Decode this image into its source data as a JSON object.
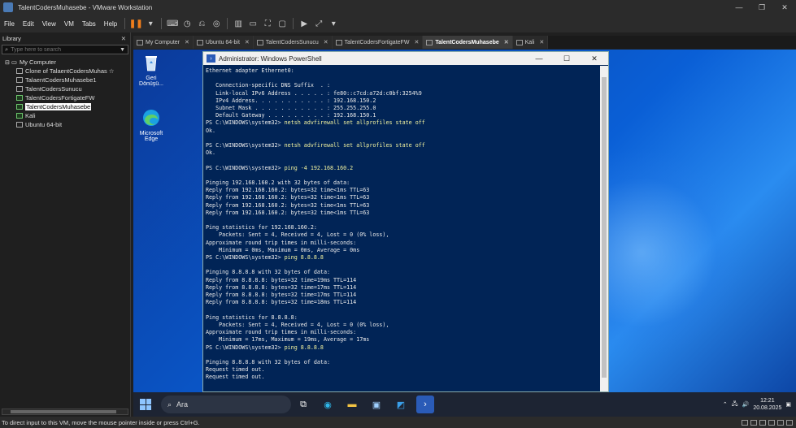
{
  "window": {
    "title": "TalentCodersMuhasebe - VMware Workstation"
  },
  "menu": [
    "File",
    "Edit",
    "View",
    "VM",
    "Tabs",
    "Help"
  ],
  "library": {
    "header": "Library",
    "search_placeholder": "Type here to search",
    "root": "My Computer",
    "items": [
      {
        "label": "Clone of TalaentCodersMuhas",
        "running": false,
        "starred": true
      },
      {
        "label": "TalaentCodersMuhasebe1",
        "running": false
      },
      {
        "label": "TalentCodersSunucu",
        "running": false
      },
      {
        "label": "TalentCodersFortigateFW",
        "running": true
      },
      {
        "label": "TalentCodersMuhasebe",
        "running": true,
        "selected": true
      },
      {
        "label": "Kali",
        "running": true
      },
      {
        "label": "Ubuntu 64-bit",
        "running": false
      }
    ]
  },
  "tabs": [
    {
      "label": "My Computer",
      "active": false
    },
    {
      "label": "Ubuntu 64-bit",
      "active": false
    },
    {
      "label": "TalentCodersSunucu",
      "active": false
    },
    {
      "label": "TalentCodersFortigateFW",
      "active": false
    },
    {
      "label": "TalentCodersMuhasebe",
      "active": true
    },
    {
      "label": "Kali",
      "active": false
    }
  ],
  "desktop": {
    "icons": [
      {
        "label": "Geri Dönüşü...",
        "icon": "recycle-bin-icon"
      },
      {
        "label": "Microsoft Edge",
        "icon": "edge-icon"
      }
    ]
  },
  "powershell": {
    "title": "Administrator: Windows PowerShell",
    "lines": [
      {
        "t": "Ethernet adapter Ethernet0:",
        "cmd": ""
      },
      {
        "t": "",
        "cmd": ""
      },
      {
        "t": "   Connection-specific DNS Suffix  . :",
        "cmd": ""
      },
      {
        "t": "   Link-local IPv6 Address . . . . . : fe80::c7cd:a72d:c0bf:3254%9",
        "cmd": ""
      },
      {
        "t": "   IPv4 Address. . . . . . . . . . . : 192.168.150.2",
        "cmd": ""
      },
      {
        "t": "   Subnet Mask . . . . . . . . . . . : 255.255.255.0",
        "cmd": ""
      },
      {
        "t": "   Default Gateway . . . . . . . . . : 192.168.150.1",
        "cmd": ""
      },
      {
        "t": "PS C:\\WINDOWS\\system32> ",
        "cmd": "netsh advfirewall set allprofiles state off"
      },
      {
        "t": "Ok.",
        "cmd": ""
      },
      {
        "t": "",
        "cmd": ""
      },
      {
        "t": "PS C:\\WINDOWS\\system32> ",
        "cmd": "netsh advfirewall set allprofiles state off"
      },
      {
        "t": "Ok.",
        "cmd": ""
      },
      {
        "t": "",
        "cmd": ""
      },
      {
        "t": "PS C:\\WINDOWS\\system32> ",
        "cmd": "ping -4 192.168.160.2"
      },
      {
        "t": "",
        "cmd": ""
      },
      {
        "t": "Pinging 192.168.160.2 with 32 bytes of data:",
        "cmd": ""
      },
      {
        "t": "Reply from 192.168.160.2: bytes=32 time<1ms TTL=63",
        "cmd": ""
      },
      {
        "t": "Reply from 192.168.160.2: bytes=32 time<1ms TTL=63",
        "cmd": ""
      },
      {
        "t": "Reply from 192.168.160.2: bytes=32 time<1ms TTL=63",
        "cmd": ""
      },
      {
        "t": "Reply from 192.168.160.2: bytes=32 time<1ms TTL=63",
        "cmd": ""
      },
      {
        "t": "",
        "cmd": ""
      },
      {
        "t": "Ping statistics for 192.168.160.2:",
        "cmd": ""
      },
      {
        "t": "    Packets: Sent = 4, Received = 4, Lost = 0 (0% loss),",
        "cmd": ""
      },
      {
        "t": "Approximate round trip times in milli-seconds:",
        "cmd": ""
      },
      {
        "t": "    Minimum = 0ms, Maximum = 0ms, Average = 0ms",
        "cmd": ""
      },
      {
        "t": "PS C:\\WINDOWS\\system32> ",
        "cmd": "ping 8.8.8.8"
      },
      {
        "t": "",
        "cmd": ""
      },
      {
        "t": "Pinging 8.8.8.8 with 32 bytes of data:",
        "cmd": ""
      },
      {
        "t": "Reply from 8.8.8.8: bytes=32 time=19ms TTL=114",
        "cmd": ""
      },
      {
        "t": "Reply from 8.8.8.8: bytes=32 time=17ms TTL=114",
        "cmd": ""
      },
      {
        "t": "Reply from 8.8.8.8: bytes=32 time=17ms TTL=114",
        "cmd": ""
      },
      {
        "t": "Reply from 8.8.8.8: bytes=32 time=18ms TTL=114",
        "cmd": ""
      },
      {
        "t": "",
        "cmd": ""
      },
      {
        "t": "Ping statistics for 8.8.8.8:",
        "cmd": ""
      },
      {
        "t": "    Packets: Sent = 4, Received = 4, Lost = 0 (0% loss),",
        "cmd": ""
      },
      {
        "t": "Approximate round trip times in milli-seconds:",
        "cmd": ""
      },
      {
        "t": "    Minimum = 17ms, Maximum = 19ms, Average = 17ms",
        "cmd": ""
      },
      {
        "t": "PS C:\\WINDOWS\\system32> ",
        "cmd": "ping 8.8.8.8"
      },
      {
        "t": "",
        "cmd": ""
      },
      {
        "t": "Pinging 8.8.8.8 with 32 bytes of data:",
        "cmd": ""
      },
      {
        "t": "Request timed out.",
        "cmd": ""
      },
      {
        "t": "Request timed out.",
        "cmd": ""
      }
    ]
  },
  "taskbar": {
    "search_label": "Ara",
    "time": "12:21",
    "date": "20.08.2025"
  },
  "status": {
    "text": "To direct input to this VM, move the mouse pointer inside or press Ctrl+G."
  },
  "colors": {
    "console_bg": "#012456",
    "accent": "#f07e1b"
  }
}
